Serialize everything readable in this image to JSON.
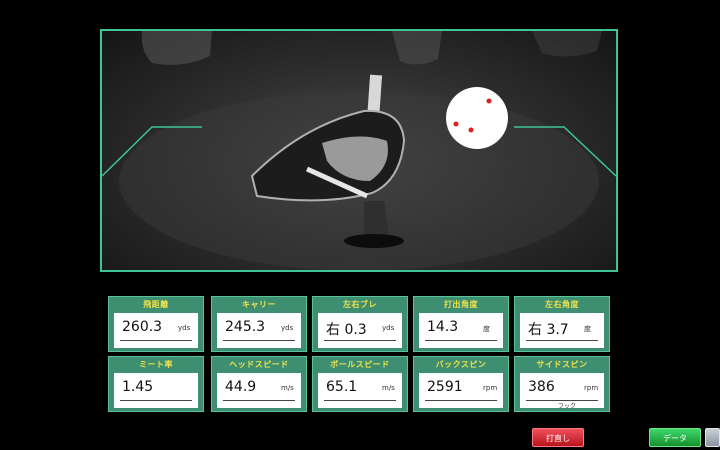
{
  "stats": [
    {
      "label": "飛距離",
      "value": "260.3",
      "unit": "yds"
    },
    {
      "label": "キャリー",
      "value": "245.3",
      "unit": "yds"
    },
    {
      "label": "左右ブレ",
      "value": "右 0.3",
      "unit": "yds"
    },
    {
      "label": "打出角度",
      "value": "14.3",
      "unit": "度"
    },
    {
      "label": "左右角度",
      "value": "右 3.7",
      "unit": "度"
    },
    {
      "label": "ミート率",
      "value": "1.45",
      "unit": ""
    },
    {
      "label": "ヘッドスピード",
      "value": "44.9",
      "unit": "m/s"
    },
    {
      "label": "ボールスピード",
      "value": "65.1",
      "unit": "m/s"
    },
    {
      "label": "バックスピン",
      "value": "2591",
      "unit": "rpm"
    },
    {
      "label": "サイドスピン",
      "value": "386",
      "unit": "rpm",
      "sub": "フック"
    }
  ],
  "buttons": {
    "retry": "打直し",
    "data": "データ"
  },
  "colors": {
    "accent": "#3ec49a",
    "card_bg": "#3e8f72",
    "label": "#f2e24a",
    "retry_button": "#d8262f",
    "data_button": "#22b548"
  }
}
